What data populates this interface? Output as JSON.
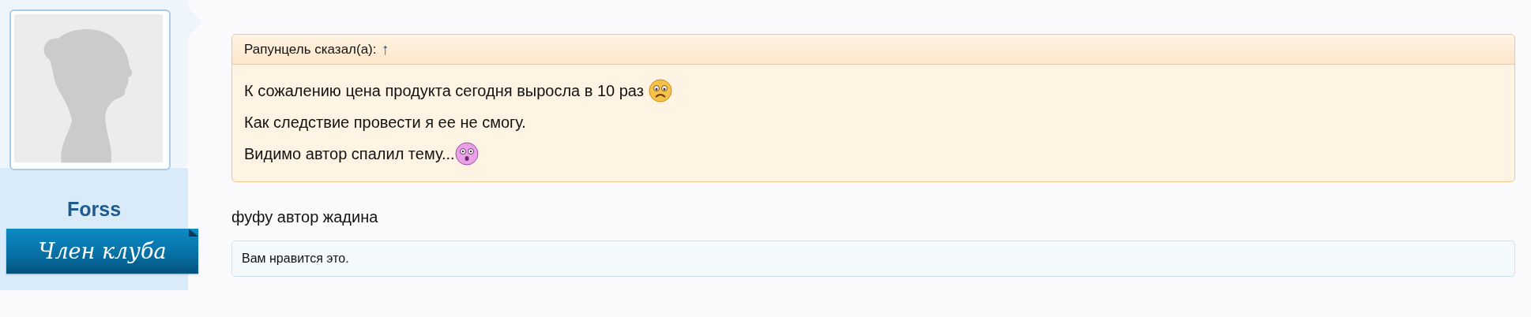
{
  "author": {
    "name": "Forss",
    "badge": "Член клуба"
  },
  "quote": {
    "attribution": "Рапунцель сказал(а):",
    "jump_link": "↑",
    "lines": [
      {
        "text": "К сожалению цена продукта сегодня выросла в 10 раз",
        "kind": "sad"
      },
      {
        "text": "Как следствие провести я ее не смогу.",
        "kind": "plain"
      },
      {
        "text": "Видимо автор спалил тему...",
        "kind": "surprised"
      }
    ]
  },
  "message": "фуфу автор жадина",
  "likes": "Вам нравится это."
}
